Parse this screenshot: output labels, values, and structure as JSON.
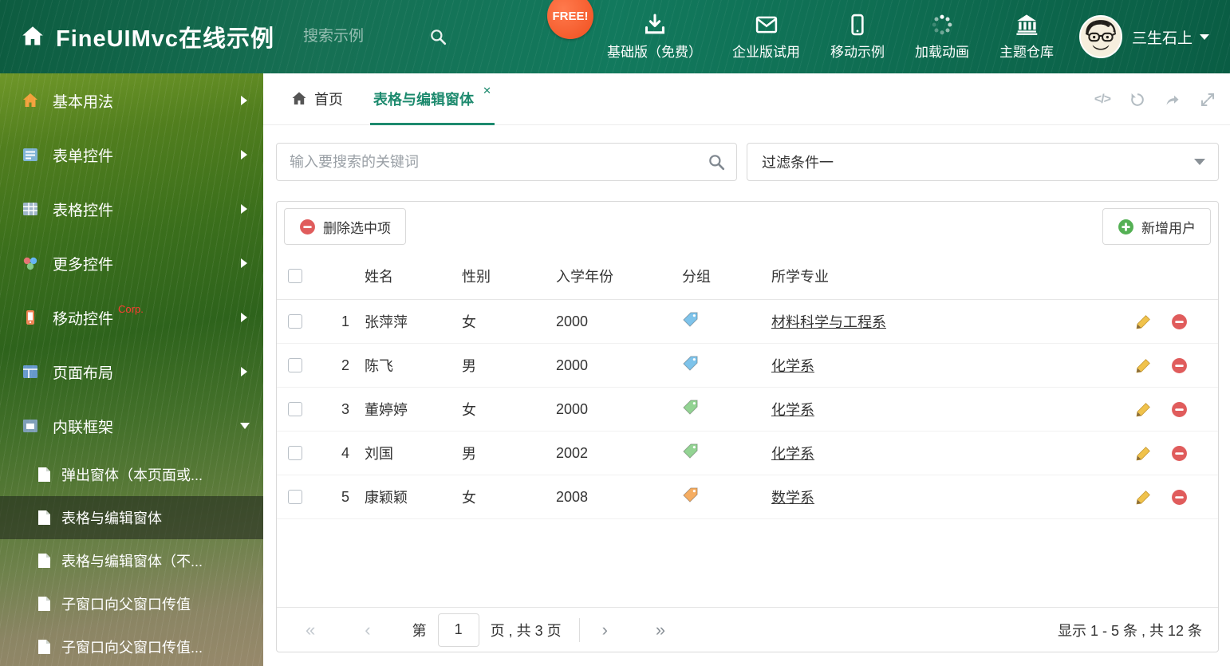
{
  "icons": {
    "close": "✕",
    "first": "«",
    "prev": "‹",
    "next": "›",
    "last": "»",
    "code": "</>"
  },
  "header": {
    "title": "FineUIMvc在线示例",
    "search_placeholder": "搜索示例",
    "free_badge": "FREE!",
    "nav_items": [
      {
        "label": "基础版（免费）"
      },
      {
        "label": "企业版试用"
      },
      {
        "label": "移动示例"
      },
      {
        "label": "加载动画"
      },
      {
        "label": "主题仓库"
      }
    ],
    "user_name": "三生石上"
  },
  "sidebar": {
    "items": [
      {
        "label": "基本用法"
      },
      {
        "label": "表单控件"
      },
      {
        "label": "表格控件"
      },
      {
        "label": "更多控件"
      },
      {
        "label": "移动控件",
        "badge": "Corp."
      },
      {
        "label": "页面布局"
      },
      {
        "label": "内联框架"
      }
    ],
    "subitems": [
      {
        "label": "弹出窗体（本页面或..."
      },
      {
        "label": "表格与编辑窗体"
      },
      {
        "label": "表格与编辑窗体（不..."
      },
      {
        "label": "子窗口向父窗口传值"
      },
      {
        "label": "子窗口向父窗口传值..."
      }
    ]
  },
  "tabs": {
    "home": "首页",
    "active": "表格与编辑窗体"
  },
  "main": {
    "search_placeholder": "输入要搜索的关键词",
    "filter_value": "过滤条件一",
    "toolbar": {
      "delete_label": "删除选中项",
      "add_label": "新增用户"
    },
    "table": {
      "columns": [
        "姓名",
        "性别",
        "入学年份",
        "分组",
        "所学专业"
      ],
      "rows": [
        {
          "index": "1",
          "name": "张萍萍",
          "gender": "女",
          "year": "2000",
          "tag_color": "#7ec3ea",
          "major": "材料科学与工程系"
        },
        {
          "index": "2",
          "name": "陈飞",
          "gender": "男",
          "year": "2000",
          "tag_color": "#7ec3ea",
          "major": "化学系"
        },
        {
          "index": "3",
          "name": "董婷婷",
          "gender": "女",
          "year": "2000",
          "tag_color": "#93d393",
          "major": "化学系"
        },
        {
          "index": "4",
          "name": "刘国",
          "gender": "男",
          "year": "2002",
          "tag_color": "#93d393",
          "major": "化学系"
        },
        {
          "index": "5",
          "name": "康颖颖",
          "gender": "女",
          "year": "2008",
          "tag_color": "#f5ad62",
          "major": "数学系"
        }
      ]
    },
    "pagination": {
      "page_label_prefix": "第",
      "page_value": "1",
      "page_label_suffix": "页 , 共 3 页",
      "summary": "显示 1 - 5 条 , 共 12 条"
    }
  },
  "colors": {
    "accent": "#1d8a6e",
    "badge": "#f04f1f",
    "danger": "#e05c5c",
    "success": "#54b054"
  }
}
